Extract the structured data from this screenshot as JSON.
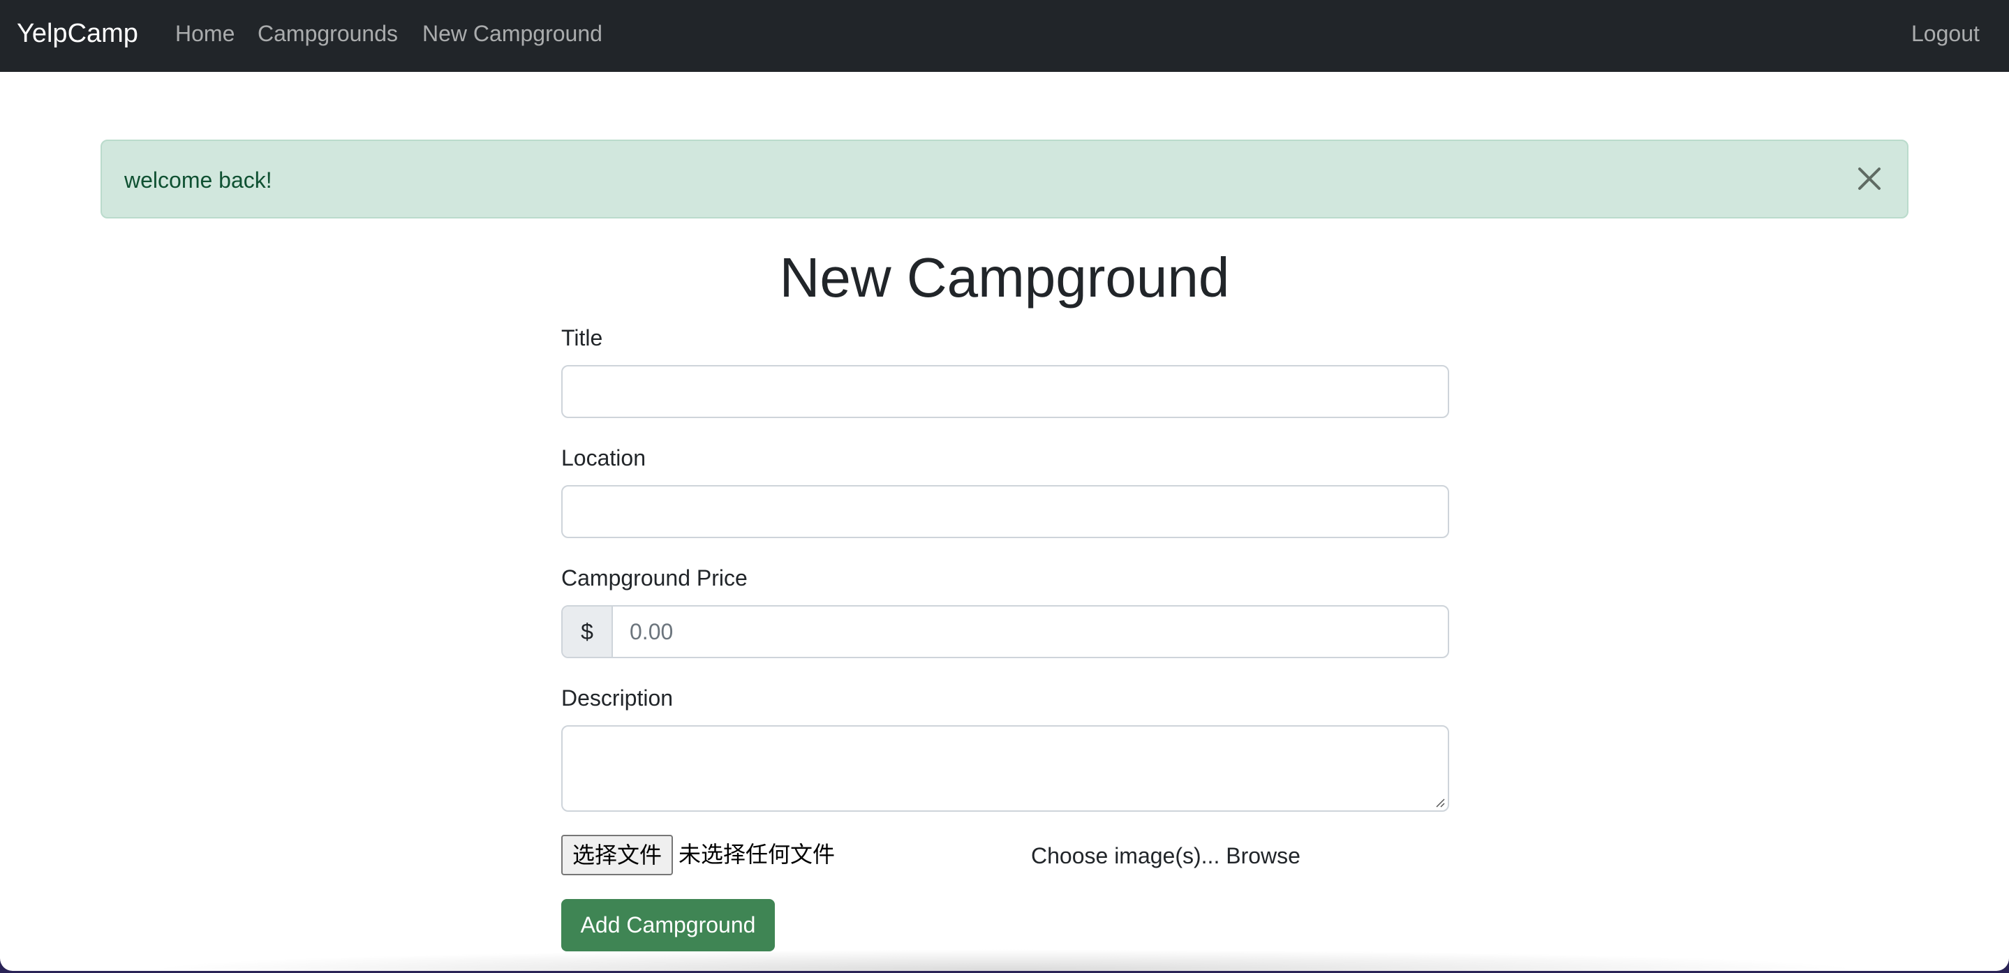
{
  "navbar": {
    "brand": "YelpCamp",
    "links": [
      {
        "label": "Home"
      },
      {
        "label": "Campgrounds"
      },
      {
        "label": "New Campground"
      }
    ],
    "logout": "Logout"
  },
  "alert": {
    "message": "welcome back!",
    "close_icon": "close-icon"
  },
  "main": {
    "title": "New Campground",
    "form": {
      "title_label": "Title",
      "title_value": "",
      "location_label": "Location",
      "location_value": "",
      "price_label": "Campground Price",
      "price_prefix": "$",
      "price_placeholder": "0.00",
      "description_label": "Description",
      "description_value": "",
      "file_button": "选择文件",
      "file_status": "未选择任何文件",
      "file_caption": "Choose image(s)... Browse",
      "submit": "Add Campground"
    }
  },
  "colors": {
    "navbar_bg": "#212529",
    "alert_bg": "#d1e7dd",
    "alert_text": "#0f5132",
    "submit_bg": "#3f8554"
  }
}
